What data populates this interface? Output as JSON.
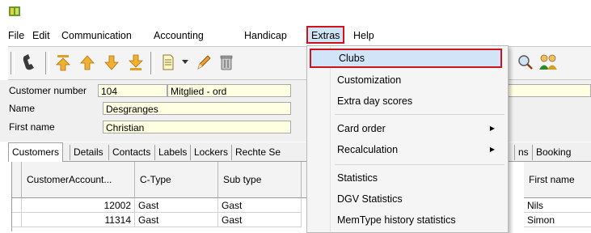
{
  "menubar": {
    "items": [
      "File",
      "Edit",
      "Communication",
      "Accounting",
      "Handicap",
      "Extras",
      "Help"
    ]
  },
  "form": {
    "customer_number_label": "Customer number",
    "customer_number_value": "104",
    "member_type_value": "Mitglied - ord",
    "name_label": "Name",
    "name_value": "Desgranges",
    "first_name_label": "First name",
    "first_name_value": "Christian"
  },
  "tabs": [
    "Customers",
    "Details",
    "Contacts",
    "Labels",
    "Lockers",
    "Rechte Se",
    "ns",
    "Booking"
  ],
  "grid": {
    "columns": [
      "CustomerAccount...",
      "C-Type",
      "Sub type",
      "First name"
    ],
    "rows": [
      {
        "account": "12002",
        "ctype": "Gast",
        "subtype": "Gast",
        "first_name": "Nils"
      },
      {
        "account": "11314",
        "ctype": "Gast",
        "subtype": "Gast",
        "first_name": "Simon"
      }
    ]
  },
  "extras_menu": {
    "items": [
      {
        "label": "Clubs"
      },
      {
        "label": "Customization"
      },
      {
        "label": "Extra day scores"
      },
      {
        "label": "Card order",
        "submenu": true
      },
      {
        "label": "Recalculation",
        "submenu": true
      },
      {
        "label": "Statistics"
      },
      {
        "label": "DGV Statistics"
      },
      {
        "label": "MemType history statistics"
      }
    ]
  },
  "colors": {
    "highlight_border": "#d0121b",
    "highlight_fill": "#d2e5f8",
    "field_bg": "#ffffe1"
  },
  "icons": [
    "app-icon",
    "phone-icon",
    "arrow-top-icon",
    "arrow-up-icon",
    "arrow-down-icon",
    "arrow-bottom-icon",
    "document-icon",
    "pencil-icon",
    "trash-icon",
    "search-person-icon",
    "users-icon"
  ]
}
